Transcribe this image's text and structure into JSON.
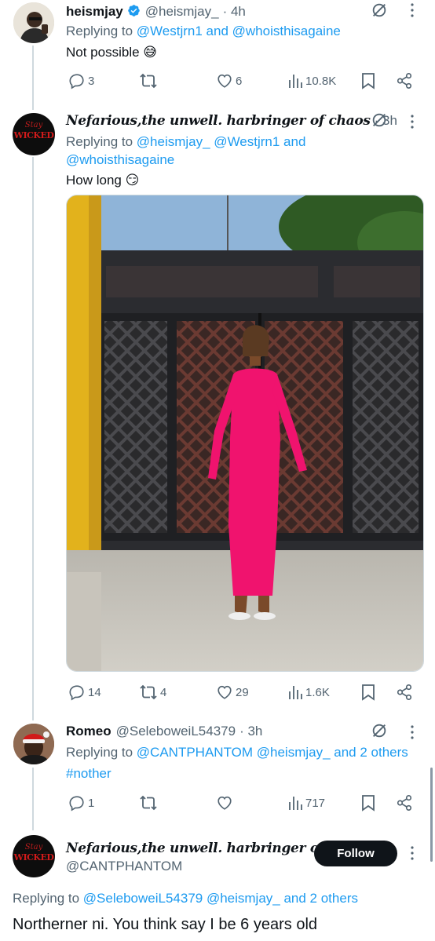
{
  "tweets": [
    {
      "name": "heismjay",
      "verified": true,
      "handle": "@heismjay_",
      "time": "· 4h",
      "replying_prefix": "Replying to",
      "replying_users": "@Westjrn1 and @whoisthisagaine",
      "text": "Not possible 😅",
      "replies": "3",
      "reposts": "",
      "likes": "6",
      "views": "10.8K"
    },
    {
      "name": "Nefarious,the unwell. harbringer of chaos",
      "handle": "",
      "time": "· 3h",
      "avatar_text_top": "Stay",
      "avatar_text": "WICKED",
      "replying_prefix": "Replying to",
      "replying_line1": "@heismjay_ @Westjrn1 and",
      "replying_line2": "@whoisthisagaine",
      "text": "How long 😏",
      "replies": "14",
      "reposts": "4",
      "likes": "29",
      "views": "1.6K"
    },
    {
      "name": "Romeo",
      "handle": "@SeleboweiL54379",
      "time": "· 3h",
      "replying_prefix": "Replying to",
      "replying_users": "@CANTPHANTOM @heismjay_ and 2 others",
      "text": "#nother",
      "replies": "1",
      "reposts": "",
      "likes": "",
      "views": "717"
    }
  ],
  "main_tweet": {
    "name": "Nefarious,the unwell. harbringer of...",
    "handle": "@CANTPHANTOM",
    "avatar_text_top": "Stay",
    "avatar_text": "WICKED",
    "follow_label": "Follow",
    "replying_prefix": "Replying to",
    "replying_users": "@SeleboweiL54379 @heismjay_ and 2 others",
    "text": "Northerner ni. You think say I be 6 years old"
  },
  "colors": {
    "accent": "#1d9bf0",
    "text": "#0f1419",
    "secondary": "#536471",
    "line": "#cfd9de",
    "dress": "#f0136e"
  },
  "icons": {
    "reply": "reply-icon",
    "repost": "repost-icon",
    "like": "heart-icon",
    "views": "views-icon",
    "bookmark": "bookmark-icon",
    "share": "share-icon",
    "grok": "grok-icon",
    "more": "more-icon",
    "verified": "verified-badge-icon"
  }
}
